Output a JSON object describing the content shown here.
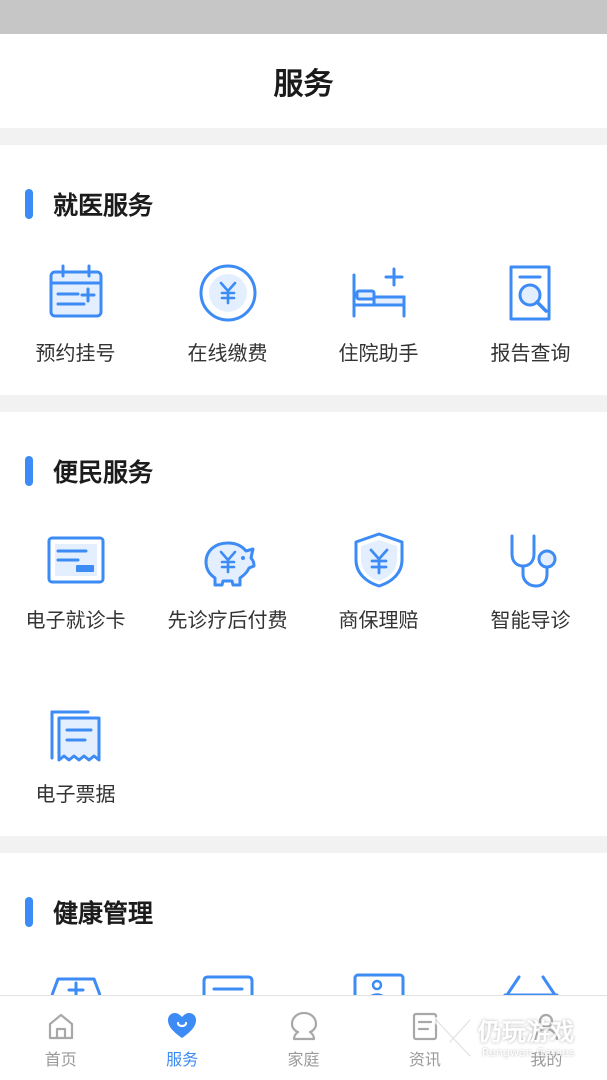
{
  "header": {
    "title": "服务"
  },
  "sections": [
    {
      "title": "就医服务",
      "items": [
        {
          "label": "预约挂号",
          "icon": "calendar-icon"
        },
        {
          "label": "在线缴费",
          "icon": "yuan-coin-icon"
        },
        {
          "label": "住院助手",
          "icon": "hospital-bed-icon"
        },
        {
          "label": "报告查询",
          "icon": "report-search-icon"
        }
      ]
    },
    {
      "title": "便民服务",
      "items": [
        {
          "label": "电子就诊卡",
          "icon": "medical-card-icon"
        },
        {
          "label": "先诊疗后付费",
          "icon": "piggy-bank-icon"
        },
        {
          "label": "商保理赔",
          "icon": "insurance-shield-icon"
        },
        {
          "label": "智能导诊",
          "icon": "stethoscope-icon"
        },
        {
          "label": "电子票据",
          "icon": "receipt-icon"
        }
      ]
    },
    {
      "title": "健康管理",
      "items": []
    }
  ],
  "tabbar": [
    {
      "label": "首页",
      "icon": "home-icon",
      "active": false
    },
    {
      "label": "服务",
      "icon": "heart-icon",
      "active": true
    },
    {
      "label": "家庭",
      "icon": "family-icon",
      "active": false
    },
    {
      "label": "资讯",
      "icon": "news-icon",
      "active": false
    },
    {
      "label": "我的",
      "icon": "profile-icon",
      "active": false
    }
  ],
  "watermark": {
    "main": "仍玩游戏",
    "sub": "Rengwan Games"
  },
  "colors": {
    "accent": "#3d8bf5",
    "icon_fill": "#e3efff",
    "tab_inactive": "#9a9a9a"
  }
}
